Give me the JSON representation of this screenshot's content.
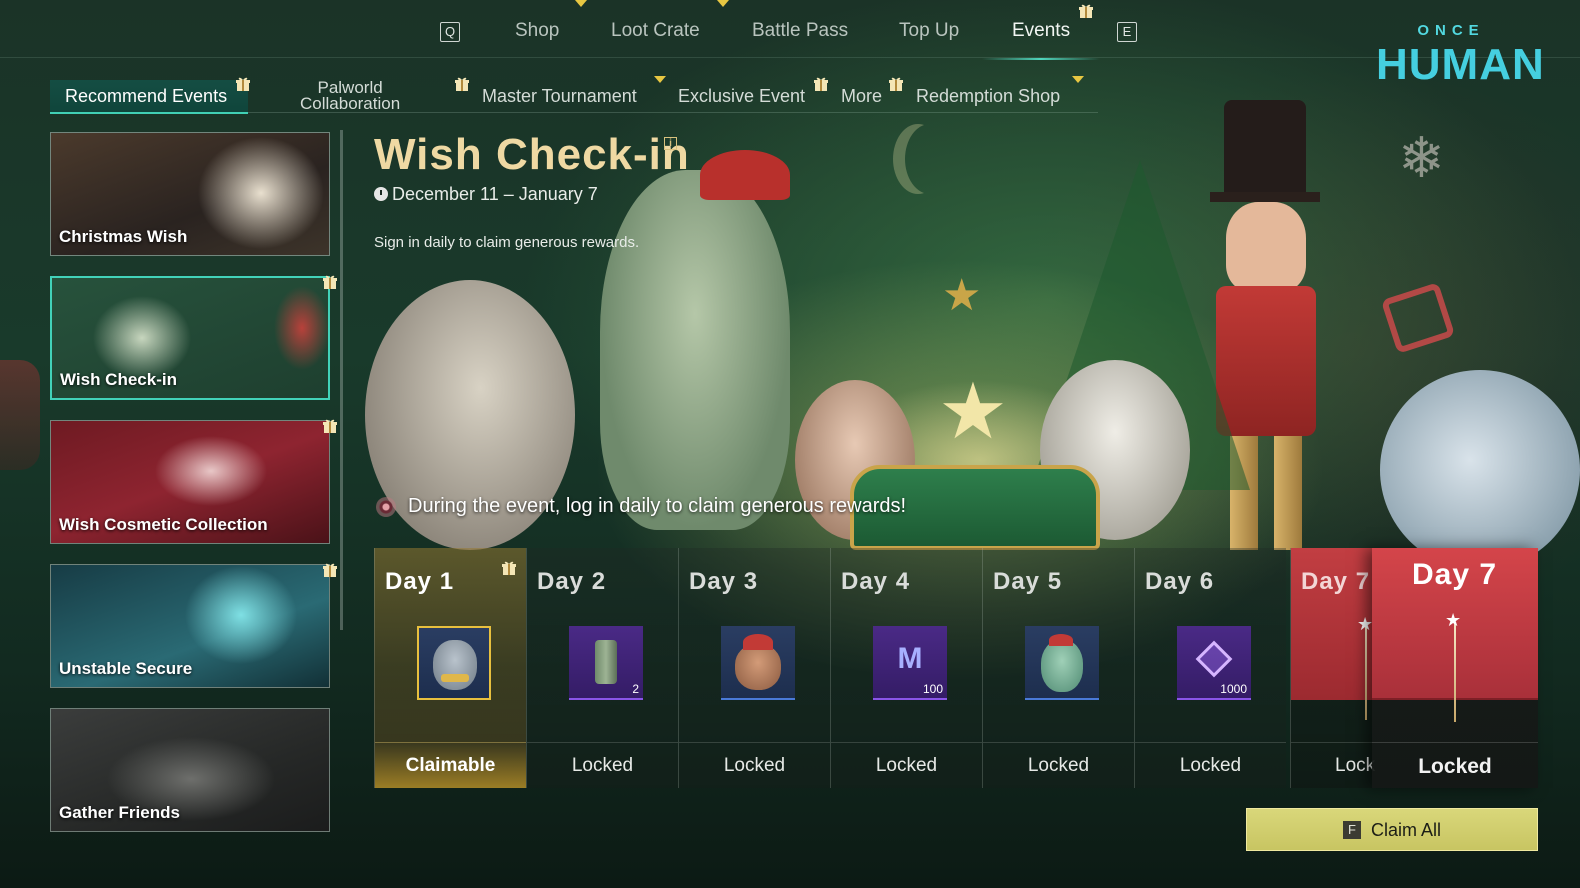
{
  "top_nav": {
    "left_key": "Q",
    "right_key": "E",
    "tabs": [
      {
        "label": "Shop"
      },
      {
        "label": "Loot Crate"
      },
      {
        "label": "Battle Pass"
      },
      {
        "label": "Top Up"
      },
      {
        "label": "Events",
        "active": true
      }
    ]
  },
  "logo": {
    "top": "ONCE",
    "main": "HUMAN"
  },
  "categories": [
    {
      "label": "Recommend Events",
      "active": true,
      "gift": true
    },
    {
      "label_line1": "Palworld",
      "label_line2": "Collaboration",
      "gift": true
    },
    {
      "label": "Master Tournament",
      "tick": true
    },
    {
      "label": "Exclusive Event",
      "gift": true
    },
    {
      "label": "More",
      "gift": true
    },
    {
      "label": "Redemption Shop",
      "tick": true
    }
  ],
  "sidebar": {
    "events": [
      {
        "label": "Christmas Wish",
        "gift": false
      },
      {
        "label": "Wish Check-in",
        "gift": true,
        "selected": true
      },
      {
        "label": "Wish Cosmetic Collection",
        "gift": true
      },
      {
        "label": "Unstable Secure",
        "gift": true
      },
      {
        "label": "Gather Friends",
        "gift": false
      }
    ]
  },
  "event": {
    "title": "Wish Check-in",
    "info_icon": "i",
    "date_range": "December 11 – January 7",
    "description": "Sign in daily to claim generous rewards.",
    "notice": "During the event, log in daily to claim generous rewards!"
  },
  "days": [
    {
      "label": "Day 1",
      "status": "Claimable",
      "reward_icon": "bear-plush-icon",
      "qty": "",
      "gift": true
    },
    {
      "label": "Day 2",
      "status": "Locked",
      "reward_icon": "canister-icon",
      "qty": "2"
    },
    {
      "label": "Day 3",
      "status": "Locked",
      "reward_icon": "santa-bear-icon",
      "qty": ""
    },
    {
      "label": "Day 4",
      "status": "Locked",
      "reward_icon": "m-emblem-icon",
      "qty": "100"
    },
    {
      "label": "Day 5",
      "status": "Locked",
      "reward_icon": "dino-plush-icon",
      "qty": ""
    },
    {
      "label": "Day 6",
      "status": "Locked",
      "reward_icon": "crystal-currency-icon",
      "qty": "1000"
    }
  ],
  "day7_back": {
    "label": "Day 7",
    "status": "Lock"
  },
  "day7": {
    "label": "Day 7",
    "status": "Locked",
    "reward_icon": "star-staff-icon"
  },
  "claim_all": {
    "key": "F",
    "label": "Claim All"
  },
  "colors": {
    "accent_teal": "#42d2b9",
    "title_gold": "#efd9a3",
    "day7_red": "#c23e42",
    "claim_button": "#d9d77a"
  }
}
